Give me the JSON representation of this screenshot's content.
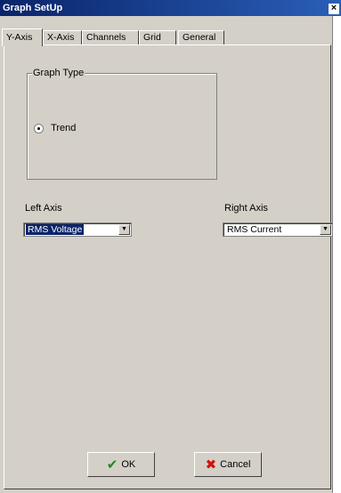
{
  "window": {
    "title": "Graph SetUp",
    "close_glyph": "×"
  },
  "tabs": [
    {
      "label": "Y-Axis",
      "active": true
    },
    {
      "label": "X-Axis",
      "active": false
    },
    {
      "label": "Channels",
      "active": false
    },
    {
      "label": "Grid",
      "active": false
    },
    {
      "label": "General",
      "active": false
    }
  ],
  "graph_type": {
    "title": "Graph Type",
    "option": {
      "label": "Trend",
      "checked": true
    }
  },
  "left_axis": {
    "label": "Left Axis",
    "value": "RMS Voltage",
    "arrow": "▼"
  },
  "right_axis": {
    "label": "Right Axis",
    "value": "RMS Current",
    "arrow": "▼"
  },
  "buttons": {
    "ok": {
      "label": "OK",
      "icon": "check-icon",
      "glyph": "✔"
    },
    "cancel": {
      "label": "Cancel",
      "icon": "x-icon",
      "glyph": "✖"
    }
  },
  "colors": {
    "title_bar": "#0a246a",
    "face": "#d4d0c8",
    "selection": "#0a246a",
    "ok_icon": "#1e8a1e",
    "cancel_icon": "#d4100a"
  }
}
